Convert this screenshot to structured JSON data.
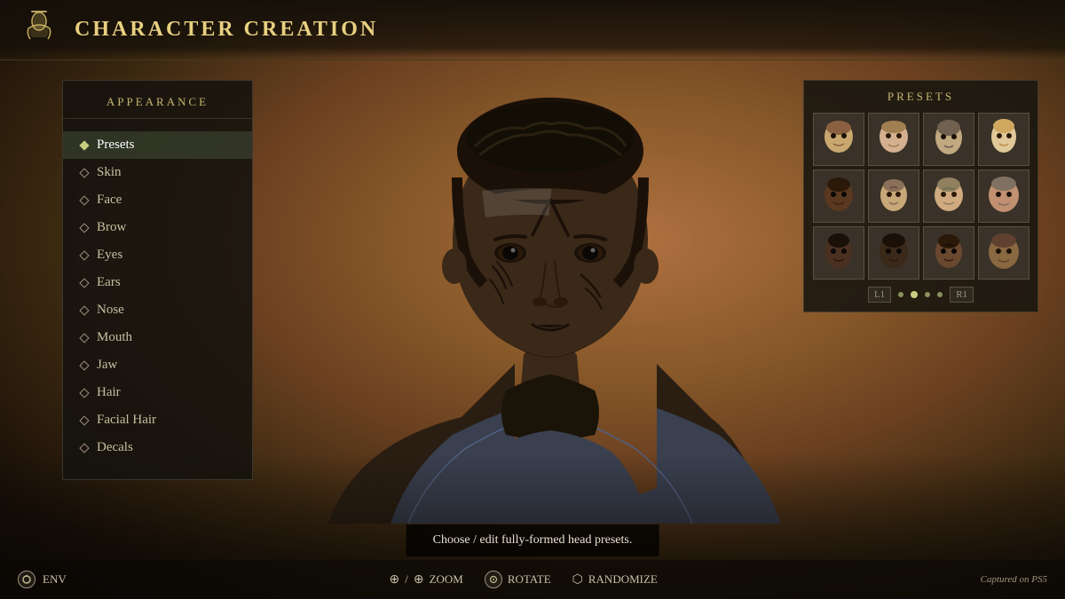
{
  "header": {
    "title": "CHARACTER CREATION",
    "icon_label": "character-icon"
  },
  "sidebar": {
    "section_title": "APPEARANCE",
    "items": [
      {
        "label": "Presets",
        "active": true,
        "diamond": "filled"
      },
      {
        "label": "Skin",
        "active": false,
        "diamond": "empty"
      },
      {
        "label": "Face",
        "active": false,
        "diamond": "empty"
      },
      {
        "label": "Brow",
        "active": false,
        "diamond": "empty"
      },
      {
        "label": "Eyes",
        "active": false,
        "diamond": "empty"
      },
      {
        "label": "Ears",
        "active": false,
        "diamond": "empty"
      },
      {
        "label": "Nose",
        "active": false,
        "diamond": "empty"
      },
      {
        "label": "Mouth",
        "active": false,
        "diamond": "empty"
      },
      {
        "label": "Jaw",
        "active": false,
        "diamond": "empty"
      },
      {
        "label": "Hair",
        "active": false,
        "diamond": "empty"
      },
      {
        "label": "Facial Hair",
        "active": false,
        "diamond": "empty"
      },
      {
        "label": "Decals",
        "active": false,
        "diamond": "empty"
      }
    ]
  },
  "presets": {
    "title": "PRESETS",
    "grid_rows": 3,
    "grid_cols": 4,
    "nav": {
      "left_btn": "L1",
      "right_btn": "R1"
    }
  },
  "hint": {
    "text": "Choose / edit fully-formed head presets."
  },
  "bottom_bar": {
    "env_label": "ENV",
    "zoom_label": "ZOOM",
    "rotate_label": "ROTATE",
    "randomize_label": "RANDOMIZE",
    "captured_on": "Captured on PS5"
  }
}
